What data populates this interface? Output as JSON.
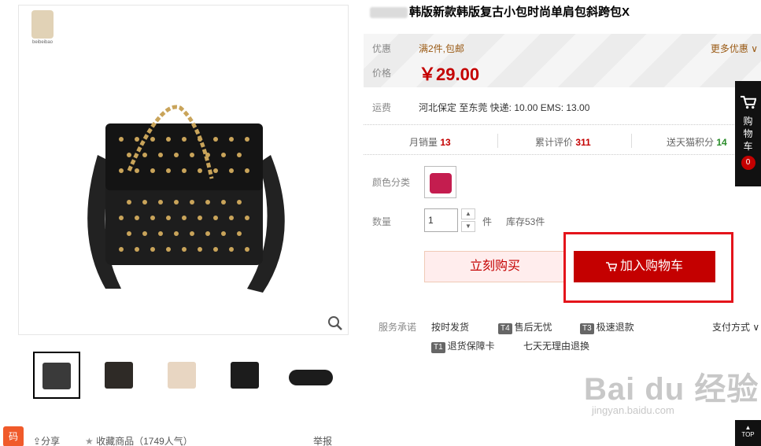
{
  "gallery": {
    "shop_logo_text": "beibeibao",
    "thumbnails": [
      {
        "color": "#3a3a3a"
      },
      {
        "color": "#2e2a26"
      },
      {
        "color": "#e8d6c2"
      },
      {
        "color": "#1c1c1c"
      },
      {
        "color": "#1c1c1c"
      }
    ]
  },
  "actions": {
    "qr_tab": "码",
    "share": "分享",
    "favorite": "收藏商品（1749人气）",
    "report": "举报"
  },
  "product": {
    "title": "韩版新款韩版复古小包时尚单肩包斜跨包X"
  },
  "promo": {
    "label": "优惠",
    "value": "满2件,包邮",
    "more": "更多优惠"
  },
  "price": {
    "label": "价格",
    "value": "￥29.00"
  },
  "shipping": {
    "label": "运费",
    "value": "河北保定  至东莞  快递: 10.00 EMS: 13.00"
  },
  "stats": {
    "monthly_sales_label": "月销量",
    "monthly_sales": "13",
    "reviews_label": "累计评价",
    "reviews": "311",
    "points_label": "送天猫积分",
    "points": "14"
  },
  "sku": {
    "color_label": "颜色分类",
    "color_swatch": "#c41d4f"
  },
  "quantity": {
    "label": "数量",
    "value": "1",
    "unit": "件",
    "stock": "库存53件"
  },
  "buttons": {
    "buy_now": "立刻购买",
    "add_to_cart": "加入购物车"
  },
  "service": {
    "label": "服务承诺",
    "items": [
      {
        "tag": "",
        "text": "按时发货"
      },
      {
        "tag": "T4",
        "text": "售后无忧"
      },
      {
        "tag": "T3",
        "text": "极速退款"
      },
      {
        "tag": "T1",
        "text": "退货保障卡"
      },
      {
        "tag": "",
        "text": "七天无理由退换"
      }
    ],
    "payment": "支付方式"
  },
  "sidebar": {
    "cart_label": "购物车",
    "cart_count": "0",
    "top_label": "TOP"
  },
  "watermark": {
    "main": "Bai du 经验",
    "url": "jingyan.baidu.com"
  },
  "colors": {
    "accent_red": "#c40000",
    "highlight_red": "#e4141b",
    "promo_brown": "#9a5a14",
    "green": "#2a8c2a"
  }
}
